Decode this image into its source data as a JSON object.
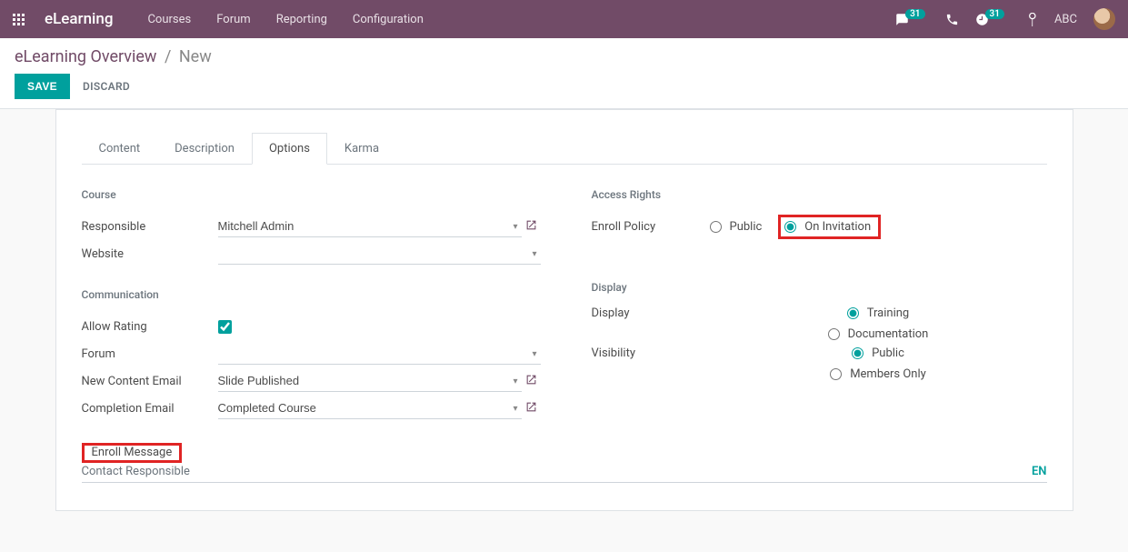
{
  "navbar": {
    "brand": "eLearning",
    "links": [
      "Courses",
      "Forum",
      "Reporting",
      "Configuration"
    ],
    "badge_messages": "31",
    "badge_activities": "31",
    "user_initials": "ABC"
  },
  "breadcrumb": {
    "parent": "eLearning Overview",
    "current": "New"
  },
  "actions": {
    "save": "SAVE",
    "discard": "DISCARD"
  },
  "tabs": [
    "Content",
    "Description",
    "Options",
    "Karma"
  ],
  "sections": {
    "course": {
      "title": "Course",
      "responsible_label": "Responsible",
      "responsible_value": "Mitchell Admin",
      "website_label": "Website",
      "website_value": ""
    },
    "access": {
      "title": "Access Rights",
      "enroll_label": "Enroll Policy",
      "enroll_options": [
        "Public",
        "On Invitation"
      ]
    },
    "communication": {
      "title": "Communication",
      "allow_rating_label": "Allow Rating",
      "forum_label": "Forum",
      "forum_value": "",
      "new_content_label": "New Content Email",
      "new_content_value": "Slide Published",
      "completion_label": "Completion Email",
      "completion_value": "Completed Course"
    },
    "display": {
      "title": "Display",
      "display_label": "Display",
      "display_options": [
        "Training",
        "Documentation"
      ],
      "visibility_label": "Visibility",
      "visibility_options": [
        "Public",
        "Members Only"
      ]
    }
  },
  "enroll": {
    "header": "Enroll Message",
    "subtext": "Contact Responsible",
    "lang": "EN"
  }
}
